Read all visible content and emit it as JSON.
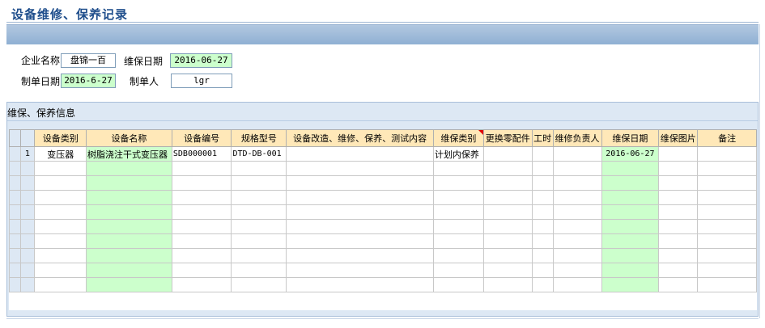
{
  "page": {
    "title": "设备维修、保养记录"
  },
  "form": {
    "company_label": "企业名称",
    "company_value": "盘锦一百",
    "maint_date_label": "维保日期",
    "maint_date_value": "2016-06-27",
    "create_date_label": "制单日期",
    "create_date_value": "2016-6-27",
    "creator_label": "制单人",
    "creator_value": "lgr"
  },
  "section": {
    "title": "维保、保养信息"
  },
  "grid": {
    "columns": [
      "设备类别",
      "设备名称",
      "设备编号",
      "规格型号",
      "设备改造、维修、保养、测试内容",
      "维保类别",
      "更换零配件",
      "工时",
      "维修负责人",
      "维保日期",
      "维保图片",
      "备注"
    ],
    "rows": [
      {
        "num": "1",
        "cells": [
          "变压器",
          "树脂浇注干式变压器",
          "SDB000001",
          "DTD-DB-001",
          "",
          "计划内保养",
          "",
          "",
          "",
          "2016-06-27",
          "",
          ""
        ]
      }
    ],
    "empty_row_count": 9
  },
  "colors": {
    "accent": "#1f4e8c",
    "header_bg": "#ffe8b8",
    "editable_green": "#ccffcc",
    "section_bg": "#dde8f4"
  }
}
